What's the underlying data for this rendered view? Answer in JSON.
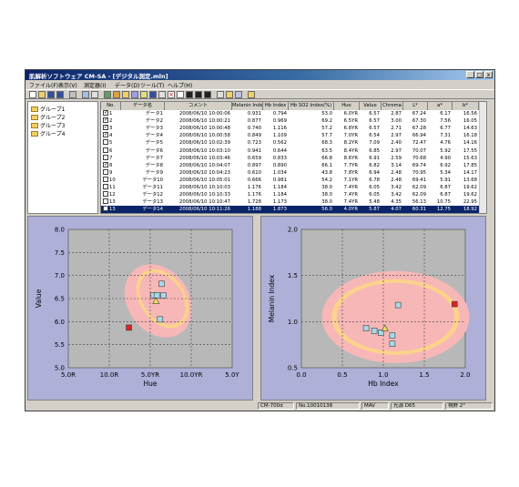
{
  "window": {
    "title": "肌解析ソフトウェア CM-SA - [デジタル測定.mln]",
    "buttons": [
      "_",
      "□",
      "x"
    ]
  },
  "menu": [
    "ファイル(F)",
    "表示(V)",
    "測定器(I)",
    "データ(D)",
    "ツール(T)",
    "ヘルプ(H)"
  ],
  "tree": {
    "groups": [
      "グループ1",
      "グループ2",
      "グループ3",
      "グループ4"
    ]
  },
  "table": {
    "columns": [
      "No.",
      "データ名",
      "コメント",
      "Melanin Index",
      "Hb Index",
      "Hb SO2 Index(%)",
      "Hue",
      "Value",
      "Chroma",
      "L*",
      "a*",
      "b*"
    ],
    "rows": [
      {
        "checked": true,
        "no": "1",
        "name": "データ1",
        "comment": "2008/06/10 10:00:06",
        "melanin": "0.931",
        "hb": "0.794",
        "hbso2": "53.0",
        "hue": "6.0YR",
        "value": "6.57",
        "chroma": "2.87",
        "l": "67.24",
        "a": "6.17",
        "b": "16.56"
      },
      {
        "checked": true,
        "no": "2",
        "name": "データ2",
        "comment": "2008/06/10 10:00:21",
        "melanin": "0.877",
        "hb": "0.969",
        "hbso2": "69.2",
        "hue": "6.5YR",
        "value": "6.57",
        "chroma": "3.00",
        "l": "67.30",
        "a": "7.56",
        "b": "16.05"
      },
      {
        "checked": true,
        "no": "3",
        "name": "データ3",
        "comment": "2008/06/10 10:00:48",
        "melanin": "0.740",
        "hb": "1.116",
        "hbso2": "57.2",
        "hue": "6.8YR",
        "value": "6.57",
        "chroma": "2.71",
        "l": "67.28",
        "a": "6.77",
        "b": "14.63"
      },
      {
        "checked": true,
        "no": "4",
        "name": "データ4",
        "comment": "2008/06/10 10:00:58",
        "melanin": "0.849",
        "hb": "1.109",
        "hbso2": "57.7",
        "hue": "7.0YR",
        "value": "6.54",
        "chroma": "2.97",
        "l": "66.94",
        "a": "7.31",
        "b": "16.18"
      },
      {
        "checked": false,
        "no": "5",
        "name": "データ5",
        "comment": "2008/06/10 10:02:39",
        "melanin": "0.723",
        "hb": "0.562",
        "hbso2": "68.3",
        "hue": "8.2YR",
        "value": "7.09",
        "chroma": "2.40",
        "l": "72.47",
        "a": "4.76",
        "b": "14.16"
      },
      {
        "checked": false,
        "no": "6",
        "name": "データ6",
        "comment": "2008/06/10 10:03:10",
        "melanin": "0.941",
        "hb": "0.644",
        "hbso2": "63.5",
        "hue": "8.4YR",
        "value": "6.85",
        "chroma": "2.97",
        "l": "70.07",
        "a": "5.92",
        "b": "17.55"
      },
      {
        "checked": false,
        "no": "7",
        "name": "データ7",
        "comment": "2008/06/10 10:03:46",
        "melanin": "0.659",
        "hb": "0.833",
        "hbso2": "66.8",
        "hue": "8.6YR",
        "value": "6.91",
        "chroma": "2.59",
        "l": "70.68",
        "a": "4.90",
        "b": "15.63"
      },
      {
        "checked": true,
        "no": "8",
        "name": "データ8",
        "comment": "2008/06/10 10:04:07",
        "melanin": "0.897",
        "hb": "0.890",
        "hbso2": "66.1",
        "hue": "7.7YR",
        "value": "6.82",
        "chroma": "3.14",
        "l": "69.74",
        "a": "6.92",
        "b": "17.85"
      },
      {
        "checked": false,
        "no": "9",
        "name": "データ9",
        "comment": "2008/06/10 10:04:23",
        "melanin": "0.610",
        "hb": "1.034",
        "hbso2": "43.8",
        "hue": "7.8YR",
        "value": "6.94",
        "chroma": "2.48",
        "l": "70.95",
        "a": "5.34",
        "b": "14.17"
      },
      {
        "checked": false,
        "no": "10",
        "name": "データ10",
        "comment": "2008/06/10 10:05:01",
        "melanin": "0.666",
        "hb": "0.981",
        "hbso2": "54.2",
        "hue": "7.1YR",
        "value": "6.78",
        "chroma": "2.48",
        "l": "69.41",
        "a": "5.91",
        "b": "13.68"
      },
      {
        "checked": false,
        "no": "11",
        "name": "データ11",
        "comment": "2008/06/10 10:10:03",
        "melanin": "1.176",
        "hb": "1.184",
        "hbso2": "38.0",
        "hue": "7.4YR",
        "value": "6.05",
        "chroma": "3.42",
        "l": "62.09",
        "a": "6.87",
        "b": "19.62"
      },
      {
        "checked": false,
        "no": "12",
        "name": "データ12",
        "comment": "2008/06/10 10:10:33",
        "melanin": "1.176",
        "hb": "1.184",
        "hbso2": "38.0",
        "hue": "7.4YR",
        "value": "6.05",
        "chroma": "3.42",
        "l": "62.09",
        "a": "6.87",
        "b": "19.62"
      },
      {
        "checked": false,
        "no": "13",
        "name": "データ13",
        "comment": "2008/06/10 10:10:47",
        "melanin": "1.728",
        "hb": "1.173",
        "hbso2": "38.0",
        "hue": "7.4YR",
        "value": "5.48",
        "chroma": "4.35",
        "l": "56.13",
        "a": "10.75",
        "b": "22.95"
      },
      {
        "checked": true,
        "no": "13",
        "name": "データ14",
        "comment": "2008/06/10 10:11:26",
        "melanin": "1.188",
        "hb": "1.873",
        "hbso2": "56.0",
        "hue": "4.0YR",
        "value": "5.87",
        "chroma": "4.07",
        "l": "60.31",
        "a": "12.75",
        "b": "18.92"
      }
    ]
  },
  "chart_data": [
    {
      "type": "scatter",
      "xlabel": "Hue",
      "ylabel": "Value",
      "x_ticks": [
        "5.0R",
        "10.0R",
        "5.0YR",
        "10.0YR",
        "5.0Y"
      ],
      "ylim": [
        5.0,
        8.0
      ],
      "y_ticks": [
        "5.0",
        "5.5",
        "6.0",
        "6.5",
        "7.0",
        "7.5",
        "8.0"
      ],
      "grid": true,
      "x_scale": "munsell-hue (5.0R=0, 10.0R=1, 5.0YR=2, 10.0YR=3, 5.0Y=4)",
      "ellipses": [
        {
          "fill": "#f7b7b7",
          "cx": 2.2,
          "cy": 6.45,
          "rx": 0.75,
          "ry": 0.85,
          "rotate": -35
        },
        {
          "fill": "#fcd38a",
          "cx": 2.3,
          "cy": 6.5,
          "rx": 0.55,
          "ry": 0.7,
          "rotate": -35
        },
        {
          "fill": "#f7b7b7",
          "cx": 2.3,
          "cy": 6.5,
          "rx": 0.48,
          "ry": 0.62,
          "rotate": -35
        }
      ],
      "points": [
        {
          "x": 1.48,
          "y": 5.87,
          "marker": "square",
          "color": "#e02020"
        },
        {
          "x": 2.08,
          "y": 6.57,
          "marker": "square",
          "color": "#a8d8e8"
        },
        {
          "x": 2.16,
          "y": 6.57,
          "marker": "square",
          "color": "#a8d8e8"
        },
        {
          "x": 2.28,
          "y": 6.82,
          "marker": "square",
          "color": "#a8d8e8"
        },
        {
          "x": 2.32,
          "y": 6.57,
          "marker": "square",
          "color": "#a8d8e8"
        },
        {
          "x": 2.24,
          "y": 6.05,
          "marker": "square",
          "color": "#a8d8e8"
        },
        {
          "x": 2.14,
          "y": 6.45,
          "marker": "triangle",
          "color": "#f0e060"
        }
      ]
    },
    {
      "type": "scatter",
      "xlabel": "Hb Index",
      "ylabel": "Melanin Index",
      "xlim": [
        0.0,
        2.0
      ],
      "x_ticks": [
        "0.0",
        "0.5",
        "1.0",
        "1.5",
        "2.0"
      ],
      "ylim": [
        0.5,
        2.0
      ],
      "y_ticks": [
        "0.5",
        "1.0",
        "1.5",
        "2.0"
      ],
      "grid": true,
      "ellipses": [
        {
          "fill": "#f7b7b7",
          "cx": 1.15,
          "cy": 1.05,
          "rx": 0.9,
          "ry": 0.5,
          "rotate": 0
        },
        {
          "fill": "#fcd38a",
          "cx": 1.15,
          "cy": 1.05,
          "rx": 0.78,
          "ry": 0.41,
          "rotate": 0
        },
        {
          "fill": "#f7b7b7",
          "cx": 1.15,
          "cy": 1.05,
          "rx": 0.72,
          "ry": 0.37,
          "rotate": 0
        }
      ],
      "points": [
        {
          "x": 1.87,
          "y": 1.19,
          "marker": "square",
          "color": "#e02020"
        },
        {
          "x": 1.18,
          "y": 1.18,
          "marker": "square",
          "color": "#a8d8e8"
        },
        {
          "x": 0.79,
          "y": 0.93,
          "marker": "square",
          "color": "#a8d8e8"
        },
        {
          "x": 0.89,
          "y": 0.9,
          "marker": "square",
          "color": "#a8d8e8"
        },
        {
          "x": 0.97,
          "y": 0.88,
          "marker": "square",
          "color": "#a8d8e8"
        },
        {
          "x": 1.11,
          "y": 0.85,
          "marker": "square",
          "color": "#a8d8e8"
        },
        {
          "x": 1.11,
          "y": 0.76,
          "marker": "square",
          "color": "#a8d8e8"
        },
        {
          "x": 1.02,
          "y": 0.93,
          "marker": "triangle",
          "color": "#f0e060"
        }
      ]
    }
  ],
  "status": [
    "CM-700d",
    "No.10010138",
    "MAV",
    "光源 D65",
    "視野 2°"
  ]
}
